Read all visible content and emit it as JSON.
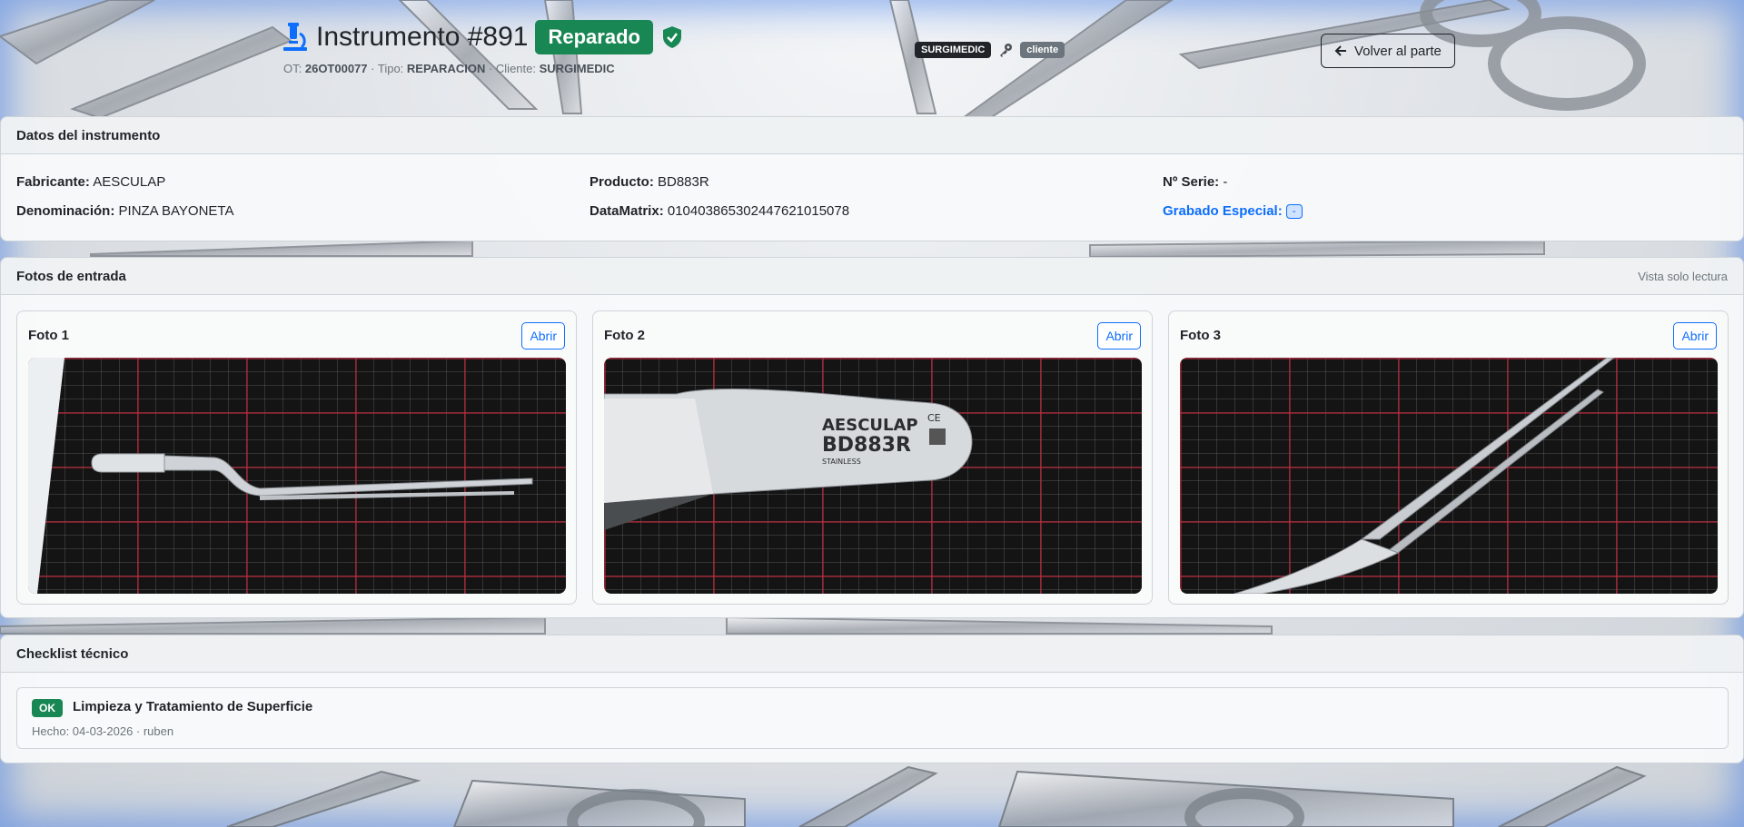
{
  "header": {
    "title": "Instrumento #891",
    "status": "Reparado",
    "ot_label": "OT:",
    "ot_value": "26OT00077",
    "tipo_label": "· Tipo:",
    "tipo_value": "REPARACION",
    "cliente_label": "· Cliente:",
    "cliente_value": "SURGIMEDIC",
    "user_badge": "SURGIMEDIC",
    "role_badge": "cliente",
    "back_label": "Volver al parte"
  },
  "datos": {
    "title": "Datos del instrumento",
    "fabricante_label": "Fabricante:",
    "fabricante": "AESCULAP",
    "producto_label": "Producto:",
    "producto": "BD883R",
    "serie_label": "Nº Serie:",
    "serie": "-",
    "denominacion_label": "Denominación:",
    "denominacion": "PINZA BAYONETA",
    "datamatrix_label": "DataMatrix:",
    "datamatrix": "01040386530244762101​5078",
    "grabado_label": "Grabado Especial:",
    "grabado": "-"
  },
  "fotos": {
    "title": "Fotos de entrada",
    "note": "Vista solo lectura",
    "open_label": "Abrir",
    "items": [
      {
        "label": "Foto 1"
      },
      {
        "label": "Foto 2",
        "engraving_brand": "AESCULAP",
        "engraving_code": "BD883R",
        "engraving_sub": "STAINLESS"
      },
      {
        "label": "Foto 3"
      }
    ]
  },
  "checklist": {
    "title": "Checklist técnico",
    "items": [
      {
        "status": "OK",
        "title": "Limpieza y Tratamiento de Superficie",
        "meta": "Hecho: 04-03-2026 · ruben"
      }
    ]
  },
  "colors": {
    "success": "#198754",
    "primary": "#0d6efd",
    "dark": "#212529",
    "muted": "#6c757d"
  }
}
